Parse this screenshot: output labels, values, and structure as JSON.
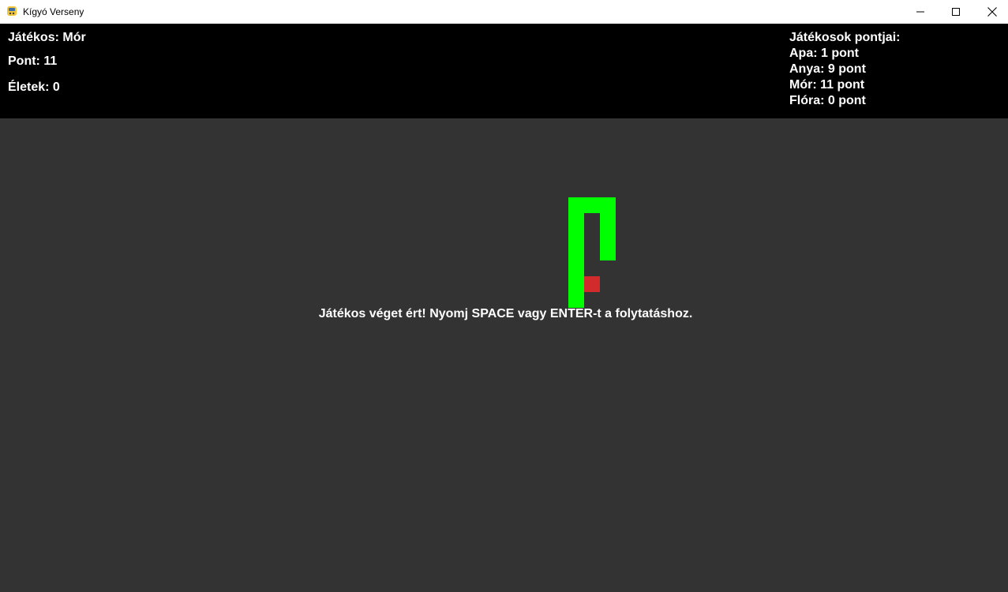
{
  "window": {
    "title": "Kígyó Verseny",
    "icon": "python-snake-icon"
  },
  "hud": {
    "player": "Játékos: Mór",
    "score": "Pont: 11",
    "lives": "Életek: 0",
    "scoreboard_title": "Játékosok pontjai:",
    "scoreboard": [
      "Apa: 1 pont",
      "Anya: 9 pont",
      "Mór: 11 pont",
      "Flóra: 0 pont"
    ]
  },
  "game": {
    "message": "Játékos véget ért! Nyomj SPACE vagy ENTER-t a folytatáshoz.",
    "snake_color": "#00ff00",
    "food_color": "#d22b2b",
    "background_color": "#333333",
    "hud_background": "#000000"
  }
}
